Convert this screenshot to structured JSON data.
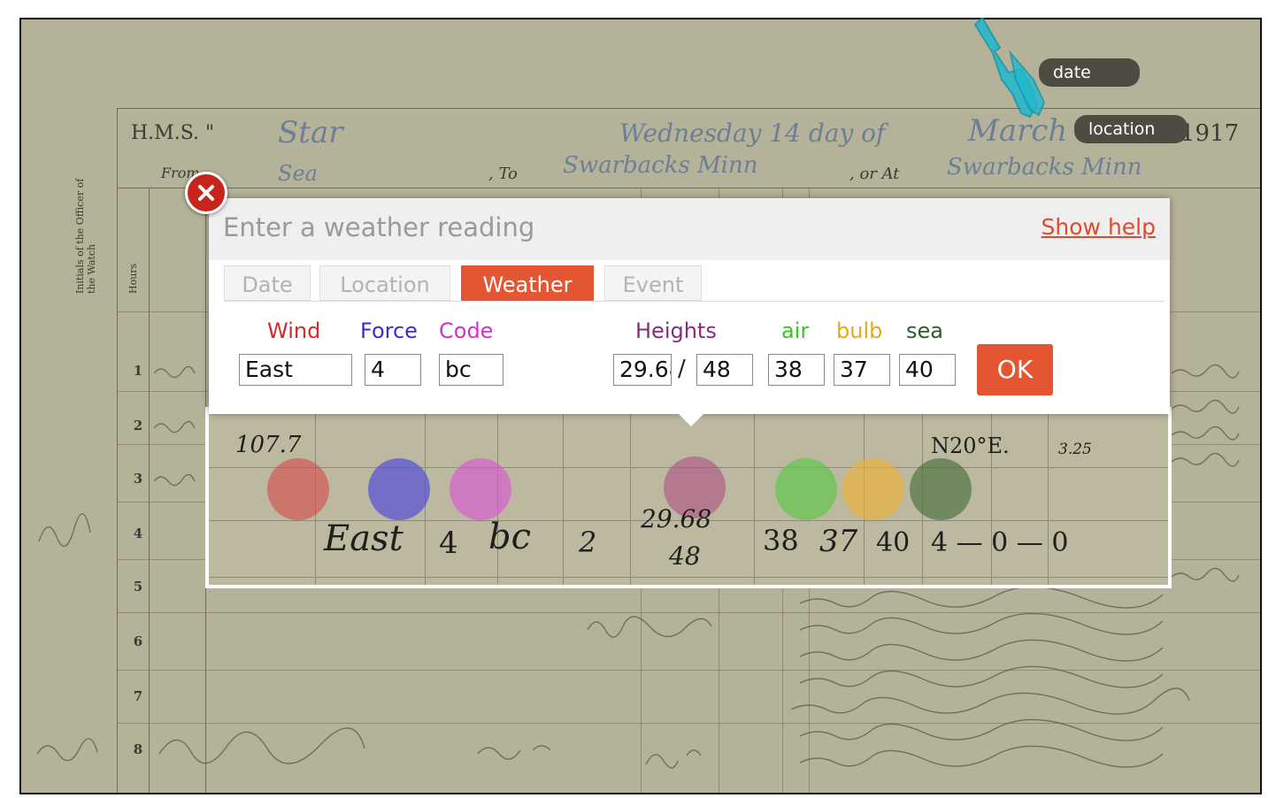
{
  "log_page": {
    "ship_prefix": "H.M.S. \"",
    "ship_name": "Star",
    "from_label": "From",
    "from_value": "Sea",
    "to_label": ", To",
    "to_value": "Swarbacks Minn",
    "day_text": "Wednesday 14 day of",
    "month_text": "March",
    "year_text": "1917",
    "at_label": ", or At",
    "at_value": "Swarbacks Minn",
    "col_hours": "Hours",
    "col_initials": "Initials of the Officer of the Watch",
    "row_numbers": [
      "1",
      "2",
      "3",
      "4",
      "5",
      "6",
      "7",
      "8"
    ]
  },
  "tags": {
    "date": "date",
    "location": "location"
  },
  "dialog": {
    "title": "Enter a weather reading",
    "help_link": "Show help",
    "tabs": [
      {
        "label": "Date",
        "active": false
      },
      {
        "label": "Location",
        "active": false
      },
      {
        "label": "Weather",
        "active": true
      },
      {
        "label": "Event",
        "active": false
      }
    ],
    "labels": {
      "wind": "Wind",
      "force": "Force",
      "code": "Code",
      "heights": "Heights",
      "air": "air",
      "bulb": "bulb",
      "sea": "sea"
    },
    "values": {
      "wind": "East",
      "force": "4",
      "code": "bc",
      "height_1": "29.68",
      "height_2": "48",
      "air": "38",
      "bulb": "37",
      "sea": "40"
    },
    "slash": "/",
    "ok_label": "OK"
  },
  "colors": {
    "accent": "#e45532",
    "wind": "#d62a2a",
    "force": "#3b2fd4",
    "code": "#cc35c6",
    "heights": "#8a2a82",
    "air": "#3fc12b",
    "bulb": "#e0a81e",
    "sea": "#2f5a2a"
  },
  "strip": {
    "values": [
      "107.7",
      "East",
      "4",
      "bc",
      "2",
      "29.68",
      "48",
      "38",
      "37",
      "40",
      "4 — 0 — 0",
      "N20°E.",
      "3.25"
    ]
  }
}
